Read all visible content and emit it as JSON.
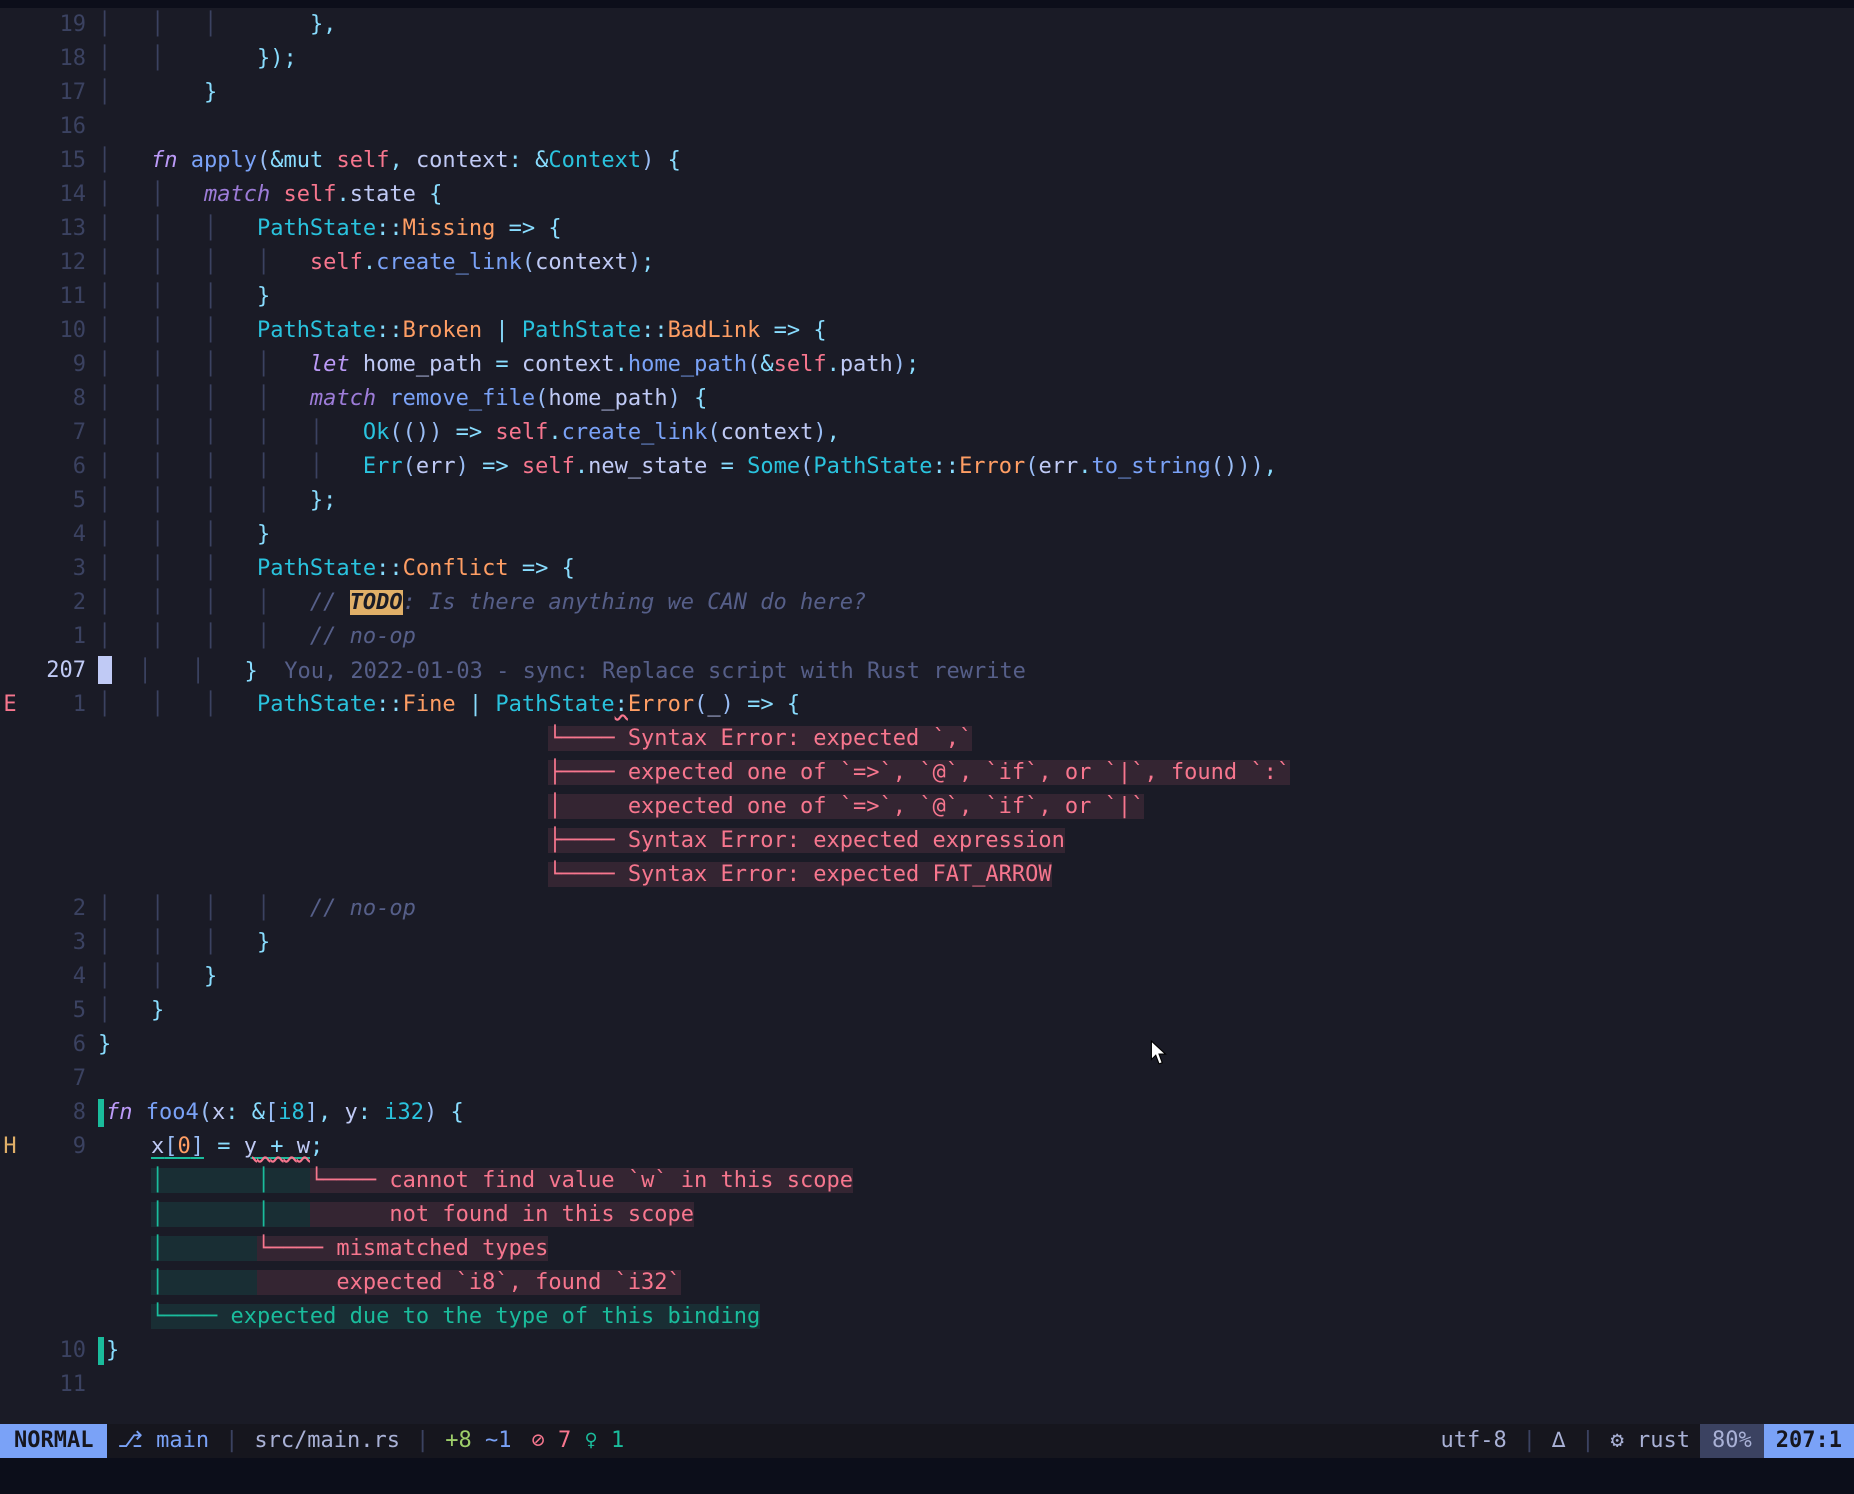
{
  "lines": [
    {
      "sign": "",
      "num": "19",
      "cur": false,
      "html": "<span class='indent'>│   │   │   </span>    <span class='punc'>},</span>"
    },
    {
      "sign": "",
      "num": "18",
      "cur": false,
      "html": "<span class='indent'>│   │   </span>    <span class='punc'>});</span>"
    },
    {
      "sign": "",
      "num": "17",
      "cur": false,
      "html": "<span class='indent'>│   </span>    <span class='punc'>}</span>"
    },
    {
      "sign": "",
      "num": "16",
      "cur": false,
      "html": ""
    },
    {
      "sign": "",
      "num": "15",
      "cur": false,
      "html": "<span class='indent'>│   </span><span class='kw'>fn</span> <span class='fn'>apply</span><span class='paren'>(</span><span class='op'>&mut</span> <span class='self'>self</span><span class='punc'>,</span> <span class='var'>context</span><span class='punc'>:</span> <span class='op'>&</span><span class='ty'>Context</span><span class='paren'>)</span> <span class='punc'>{</span>"
    },
    {
      "sign": "",
      "num": "14",
      "cur": false,
      "html": "<span class='indent'>│   │   </span><span class='kw2'>match</span> <span class='self'>self</span><span class='punc'>.</span><span class='var'>state</span> <span class='punc'>{</span>"
    },
    {
      "sign": "",
      "num": "13",
      "cur": false,
      "html": "<span class='indent'>│   │   │   </span><span class='ty'>PathState</span><span class='punc'>::</span><span class='enum'>Missing</span> <span class='op'>=&gt;</span> <span class='punc'>{</span>"
    },
    {
      "sign": "",
      "num": "12",
      "cur": false,
      "html": "<span class='indent'>│   │   │   │   </span><span class='self'>self</span><span class='punc'>.</span><span class='fn'>create_link</span><span class='paren'>(</span><span class='var'>context</span><span class='paren'>)</span><span class='punc'>;</span>"
    },
    {
      "sign": "",
      "num": "11",
      "cur": false,
      "html": "<span class='indent'>│   │   │   </span><span class='punc'>}</span>"
    },
    {
      "sign": "",
      "num": "10",
      "cur": false,
      "html": "<span class='indent'>│   │   │   </span><span class='ty'>PathState</span><span class='punc'>::</span><span class='enum'>Broken</span> <span class='op'>|</span> <span class='ty'>PathState</span><span class='punc'>::</span><span class='enum'>BadLink</span> <span class='op'>=&gt;</span> <span class='punc'>{</span>"
    },
    {
      "sign": "",
      "num": "9",
      "cur": false,
      "html": "<span class='indent'>│   │   │   │   </span><span class='kw'>let</span> <span class='var'>home_path</span> <span class='op'>=</span> <span class='var'>context</span><span class='punc'>.</span><span class='fn'>home_path</span><span class='paren'>(</span><span class='op'>&</span><span class='self'>self</span><span class='punc'>.</span><span class='var'>path</span><span class='paren'>)</span><span class='punc'>;</span>"
    },
    {
      "sign": "",
      "num": "8",
      "cur": false,
      "html": "<span class='indent'>│   │   │   │   </span><span class='kw2'>match</span> <span class='fn'>remove_file</span><span class='paren'>(</span><span class='var'>home_path</span><span class='paren'>)</span> <span class='punc'>{</span>"
    },
    {
      "sign": "",
      "num": "7",
      "cur": false,
      "html": "<span class='indent'>│   │   │   │   │   </span><span class='ty'>Ok</span><span class='paren'>((</span><span class='paren'>))</span> <span class='op'>=&gt;</span> <span class='self'>self</span><span class='punc'>.</span><span class='fn'>create_link</span><span class='paren'>(</span><span class='var'>context</span><span class='paren'>)</span><span class='punc'>,</span>"
    },
    {
      "sign": "",
      "num": "6",
      "cur": false,
      "html": "<span class='indent'>│   │   │   │   │   </span><span class='ty'>Err</span><span class='paren'>(</span><span class='var'>err</span><span class='paren'>)</span> <span class='op'>=&gt;</span> <span class='self'>self</span><span class='punc'>.</span><span class='var'>new_state</span> <span class='op'>=</span> <span class='ty'>Some</span><span class='paren'>(</span><span class='ty'>PathState</span><span class='punc'>::</span><span class='enum'>Error</span><span class='paren'>(</span><span class='var'>err</span><span class='punc'>.</span><span class='fn'>to_string</span><span class='paren'>()))</span><span class='punc'>,</span>"
    },
    {
      "sign": "",
      "num": "5",
      "cur": false,
      "html": "<span class='indent'>│   │   │   │   </span><span class='punc'>};</span>"
    },
    {
      "sign": "",
      "num": "4",
      "cur": false,
      "html": "<span class='indent'>│   │   │   </span><span class='punc'>}</span>"
    },
    {
      "sign": "",
      "num": "3",
      "cur": false,
      "html": "<span class='indent'>│   │   │   </span><span class='ty'>PathState</span><span class='punc'>::</span><span class='enum'>Conflict</span> <span class='op'>=&gt;</span> <span class='punc'>{</span>"
    },
    {
      "sign": "",
      "num": "2",
      "cur": false,
      "html": "<span class='indent'>│   │   │   │   </span><span class='com'>// </span><span class='todo'>TODO</span><span class='com'>: Is there anything we CAN do here?</span>"
    },
    {
      "sign": "",
      "num": "1",
      "cur": false,
      "html": "<span class='indent'>│   │   │   │   </span><span class='com'>// no-op</span>"
    },
    {
      "sign": "",
      "num": "207",
      "cur": true,
      "html": "<span class='cursor-block'></span><span class='indent'>  │   │   </span><span class='punc'>}</span>  <span class='inlay'>You, 2022-01-03 - sync: Replace script with Rust rewrite</span>"
    },
    {
      "sign": "E",
      "num": "1",
      "cur": false,
      "html": "<span class='indent'>│   │   │   </span><span class='ty'>PathState</span><span class='punc'>::</span><span class='enum'>Fine</span> <span class='op'>|</span> <span class='ty'>PathState</span><span class='err-underline'><span class='punc'>:</span></span><span class='enum'>Error</span><span class='paren'>(</span><span class='var'>_</span><span class='paren'>)</span> <span class='op'>=&gt;</span> <span class='punc'>{</span>"
    },
    {
      "sign": "",
      "num": "",
      "cur": false,
      "html": "                                  <span class='diag-err'>└──── Syntax Error: expected `,`</span>"
    },
    {
      "sign": "",
      "num": "",
      "cur": false,
      "html": "                                  <span class='diag-err'>├──── expected one of `=&gt;`, `@`, `if`, or `|`, found `:`</span>"
    },
    {
      "sign": "",
      "num": "",
      "cur": false,
      "html": "                                  <span class='diag-err'>│     expected one of `=&gt;`, `@`, `if`, or `|`</span>"
    },
    {
      "sign": "",
      "num": "",
      "cur": false,
      "html": "                                  <span class='diag-err'>├──── Syntax Error: expected expression</span>"
    },
    {
      "sign": "",
      "num": "",
      "cur": false,
      "html": "                                  <span class='diag-err'>└──── Syntax Error: expected FAT_ARROW</span>"
    },
    {
      "sign": "",
      "num": "2",
      "cur": false,
      "html": "<span class='indent'>│   │   │   │   </span><span class='com'>// no-op</span>"
    },
    {
      "sign": "",
      "num": "3",
      "cur": false,
      "html": "<span class='indent'>│   │   │   </span><span class='punc'>}</span>"
    },
    {
      "sign": "",
      "num": "4",
      "cur": false,
      "html": "<span class='indent'>│   │   </span><span class='punc'>}</span>"
    },
    {
      "sign": "",
      "num": "5",
      "cur": false,
      "html": "<span class='indent'>│   </span><span class='punc'>}</span>"
    },
    {
      "sign": "",
      "num": "6",
      "cur": false,
      "html": "<span class='punc'>}</span>"
    },
    {
      "sign": "",
      "num": "7",
      "cur": false,
      "html": ""
    },
    {
      "sign": "",
      "num": "8",
      "cur": false,
      "html": "<span class='diag-hint-bar'></span><span class='kw'>fn</span> <span class='fn'>foo4</span><span class='paren'>(</span><span class='var'>x</span><span class='punc'>:</span> <span class='op'>&</span><span class='paren'>[</span><span class='ty'>i8</span><span class='paren'>]</span><span class='punc'>,</span> <span class='var'>y</span><span class='punc'>:</span> <span class='ty'>i32</span><span class='paren'>)</span> <span class='punc'>{</span>"
    },
    {
      "sign": "H",
      "num": "9",
      "cur": false,
      "html": "    <span class='hint-underline'><span class='var'>x</span><span class='paren'>[</span><span class='num'>0</span><span class='paren'>]</span></span> <span class='op'>=</span> <span class='hint-underline'><span class='err-underline'><span class='var'>y</span> <span class='op'>+</span> <span class='var'>w</span></span></span><span class='punc'>;</span>"
    },
    {
      "sign": "",
      "num": "",
      "cur": false,
      "html": "    <span class='diag-hint'>│       │   </span><span class='diag-err'>└──── cannot find value `w` in this scope</span>"
    },
    {
      "sign": "",
      "num": "",
      "cur": false,
      "html": "    <span class='diag-hint'>│       │   </span><span class='diag-err'>      not found in this scope</span>"
    },
    {
      "sign": "",
      "num": "",
      "cur": false,
      "html": "    <span class='diag-hint'>│       </span><span class='diag-err'>└──── mismatched types</span>"
    },
    {
      "sign": "",
      "num": "",
      "cur": false,
      "html": "    <span class='diag-hint'>│       </span><span class='diag-err'>      expected `i8`, found `i32`</span>"
    },
    {
      "sign": "",
      "num": "",
      "cur": false,
      "html": "    <span class='diag-hint'>└──── expected due to the type of this binding</span>"
    },
    {
      "sign": "",
      "num": "10",
      "cur": false,
      "html": "<span class='diag-hint-bar'></span><span class='punc'>}</span>"
    },
    {
      "sign": "",
      "num": "11",
      "cur": false,
      "html": ""
    }
  ],
  "statusline": {
    "mode": "NORMAL",
    "branch_icon": "⎇",
    "branch": "main",
    "file": "src/main.rs",
    "git_add": "+8",
    "git_change": "~1",
    "diag_err_icon": "⊘",
    "diag_err_count": "7",
    "diag_hint_icon": "♀",
    "diag_hint_count": "1",
    "encoding": "utf-8",
    "fileformat_icon": "∆",
    "filetype_icon": "⚙",
    "filetype": "rust",
    "percent": "80%",
    "position": "207:1"
  }
}
